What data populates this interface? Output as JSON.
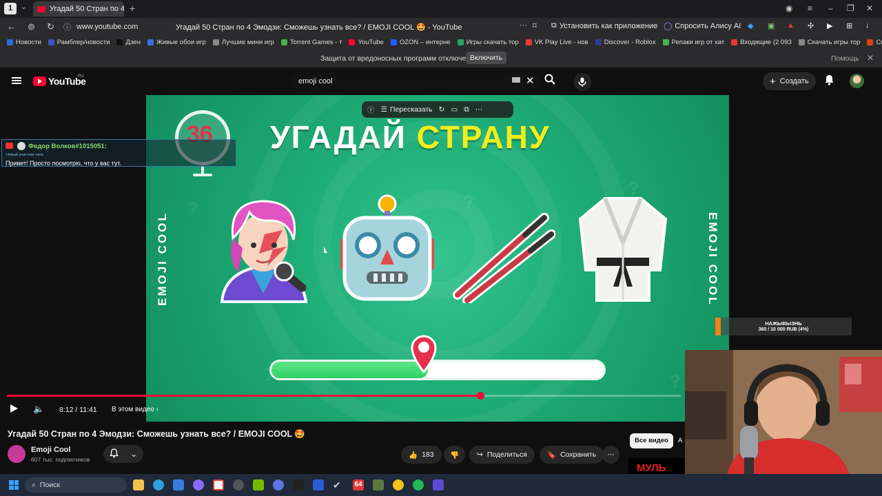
{
  "browser": {
    "tab_number": "1",
    "tab_title": "Угадай 50 Стран по 4 Э",
    "url": "www.youtube.com",
    "page_title": "Угадай 50 Стран по 4 Эмодзи: Сможешь узнать все? / EMOJI COOL 🤩 - YouTube",
    "install_app": "Установить как приложение",
    "ask_alice": "Спросить Алису AI"
  },
  "bookmarks": [
    {
      "label": "Новости",
      "color": "#2d6cdf"
    },
    {
      "label": "Рамблер/новости",
      "color": "#3557c9"
    },
    {
      "label": "Дзен",
      "color": "#111111"
    },
    {
      "label": "Живые обои игр",
      "color": "#3b6fe0"
    },
    {
      "label": "Лучшие мини игр",
      "color": "#888888"
    },
    {
      "label": "Torrent Games - т",
      "color": "#4caf50"
    },
    {
      "label": "YouTube",
      "color": "#ff0033"
    },
    {
      "label": "OZON – интерне",
      "color": "#1f5fff"
    },
    {
      "label": "Игры скачать тор",
      "color": "#29a36a"
    },
    {
      "label": "VK Play Live - нов",
      "color": "#e53935"
    },
    {
      "label": "Discover - Roblox",
      "color": "#2c3e8f"
    },
    {
      "label": "Репаки игр от хат",
      "color": "#4caf50"
    },
    {
      "label": "Входящие (2 093",
      "color": "#e53935"
    },
    {
      "label": "Скачать игры тор",
      "color": "#888888"
    },
    {
      "label": "Скачать игры",
      "color": "#d84315"
    }
  ],
  "protection": {
    "message": "Защита от вредоносных программ отключена",
    "enable_button": "Включить",
    "help": "Помощь"
  },
  "youtube": {
    "logo": "YouTube",
    "region": "RU",
    "search_value": "emoji cool",
    "create_button": "Создать"
  },
  "video_toolbar": {
    "retell": "Пересказать"
  },
  "video": {
    "title_white": "УГАДАЙ",
    "title_yellow": "СТРАНУ",
    "counter": "36",
    "side_text_left": "EMOJI COOL",
    "side_text_right": "EMOJI COOL",
    "emojis": [
      "singer-icon",
      "robot-icon",
      "chopsticks-icon",
      "kimono-icon"
    ]
  },
  "player": {
    "time": "8:12 / 11:41",
    "chapter": "В этом видео",
    "played_fraction": 0.702,
    "level_progress_fraction": 0.47,
    "colors": {
      "accent": "#ff0033",
      "green": "#2fcf63",
      "yellow": "#f2ee1c"
    }
  },
  "chat": {
    "user": "Федор Волков#1015051:",
    "badge": "Новый участник чата",
    "message": "Привет! Просто посмотрю, что у вас тут."
  },
  "donation": {
    "title": "НАЖЫВЫЗНЬ",
    "value": "360 / 10 000 RUB (4%)"
  },
  "meta": {
    "title": "Угадай 50 Стран по 4 Эмодзи: Сможешь узнать все? / EMOJI COOL 🤩",
    "channel": "Emoji Cool",
    "subscribers": "607 тыс. подписчиков",
    "likes": "183",
    "share": "Поделиться",
    "save": "Сохранить",
    "all_videos": "Все видео",
    "all_videos_next": "А",
    "thumb_text": "МУЛЬ"
  },
  "taskbar": {
    "search": "Поиск"
  }
}
